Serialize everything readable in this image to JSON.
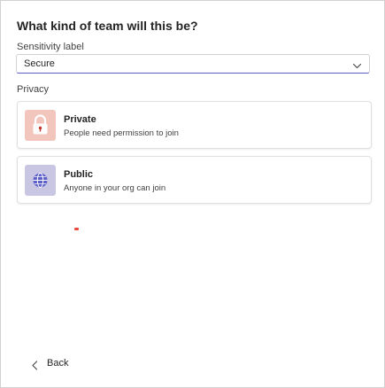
{
  "dialog": {
    "title": "What kind of team will this be?",
    "sensitivity": {
      "label": "Sensitivity label",
      "selected": "Secure",
      "icon": "chevron-down-icon"
    },
    "privacy_label": "Privacy",
    "options": [
      {
        "title": "Private",
        "description": "People need permission to join",
        "icon": "lock-icon",
        "icon_bg": "#f2c5bd",
        "icon_color": "#c0392b"
      },
      {
        "title": "Public",
        "description": "Anyone in your org can join",
        "icon": "globe-icon",
        "icon_bg": "#c9c6e3",
        "icon_color": "#5b5fc7"
      }
    ],
    "back_label": "Back"
  },
  "colors": {
    "accent": "#5b5fc7",
    "border": "#d1d1d1"
  }
}
